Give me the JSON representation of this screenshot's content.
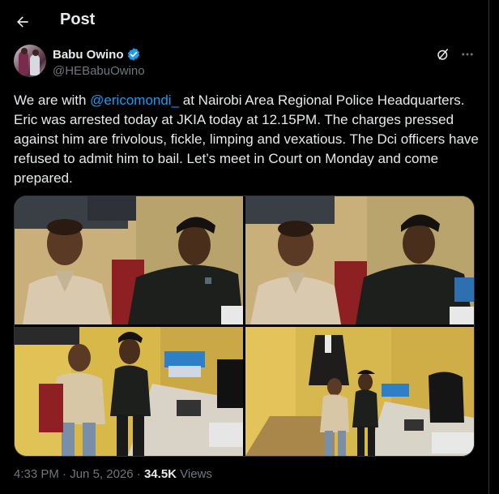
{
  "header": {
    "title": "Post"
  },
  "author": {
    "name": "Babu Owino",
    "handle": "@HEBabuOwino"
  },
  "tweet": {
    "part1": "We are with ",
    "mention": "@ericomondi_",
    "part2": "  at Nairobi Area Regional Police Headquarters. Eric was arrested today at JKIA today at 12.15PM. The charges pressed against him are frivolous, fickle, limping and vexatious. The Dci officers have refused to admit him to bail. Let’s meet in Court on Monday and come prepared."
  },
  "meta": {
    "time": "4:33 PM",
    "separator": " · ",
    "date": "Jun 5, 2026",
    "views_count": "34.5K",
    "views_label": " Views"
  },
  "icons": {
    "back": "arrow-left-icon",
    "verified": "verified-badge-icon",
    "grok": "grok-icon",
    "more": "more-dots-icon"
  },
  "colors": {
    "accent": "#1d9bf0",
    "muted": "#71767b",
    "text": "#e7e9ea",
    "background": "#000000"
  }
}
